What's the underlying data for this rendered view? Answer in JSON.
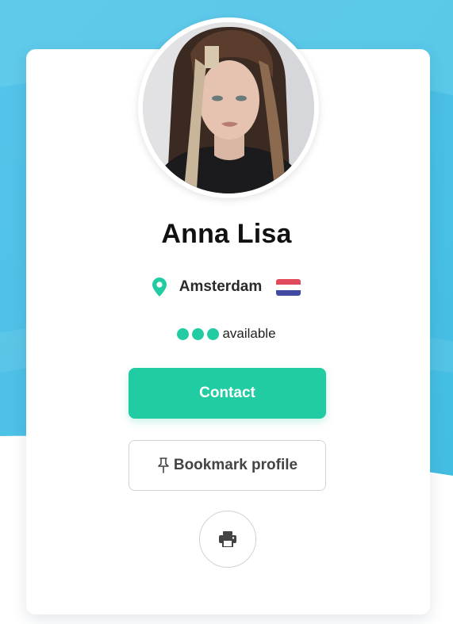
{
  "profile": {
    "name": "Anna Lisa",
    "location": "Amsterdam",
    "country_flag": "netherlands-flag",
    "status_label": "available",
    "status_dots": 3
  },
  "actions": {
    "contact_label": "Contact",
    "bookmark_label": "Bookmark profile",
    "print_icon": "printer-icon"
  },
  "icons": {
    "location": "map-pin-icon",
    "bookmark": "push-pin-icon"
  },
  "colors": {
    "accent": "#22cca3",
    "background_blue": "#4cc3e6",
    "text_dark": "#111111"
  }
}
